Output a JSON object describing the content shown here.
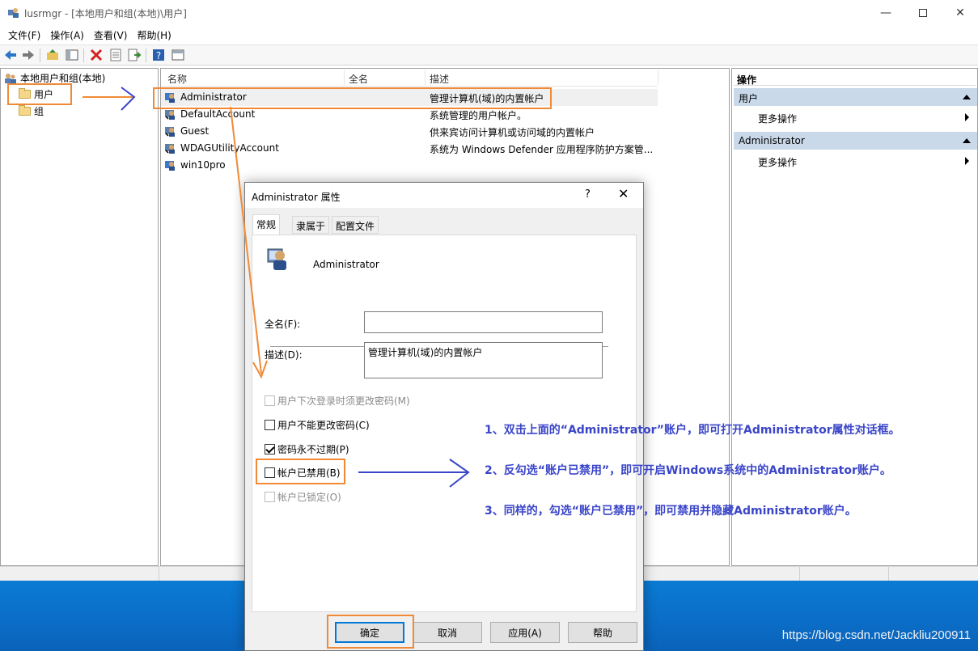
{
  "window": {
    "title": "lusrmgr - [本地用户和组(本地)\\用户]"
  },
  "menu": [
    "文件(F)",
    "操作(A)",
    "查看(V)",
    "帮助(H)"
  ],
  "tree": {
    "root": "本地用户和组(本地)",
    "users": "用户",
    "groups": "组"
  },
  "list": {
    "columns": [
      "名称",
      "全名",
      "描述"
    ],
    "rows": [
      {
        "name": "Administrator",
        "desc": "管理计算机(域)的内置帐户"
      },
      {
        "name": "DefaultAccount",
        "desc": "系统管理的用户帐户。"
      },
      {
        "name": "Guest",
        "desc": "供来宾访问计算机或访问域的内置帐户"
      },
      {
        "name": "WDAGUtilityAccount",
        "desc": "系统为 Windows Defender 应用程序防护方案管..."
      },
      {
        "name": "win10pro",
        "desc": ""
      }
    ]
  },
  "actions": {
    "header": "操作",
    "section1": "用户",
    "section1_more": "更多操作",
    "section2": "Administrator",
    "section2_more": "更多操作"
  },
  "dialog": {
    "title": "Administrator 属性",
    "help": "?",
    "close": "✕",
    "tabs": [
      "常规",
      "隶属于",
      "配置文件"
    ],
    "username": "Administrator",
    "fullname_label": "全名(F):",
    "fullname_value": "",
    "desc_label": "描述(D):",
    "desc_value": "管理计算机(域)的内置帐户",
    "checkboxes": [
      {
        "label": "用户下次登录时须更改密码(M)",
        "checked": false,
        "disabled": true
      },
      {
        "label": "用户不能更改密码(C)",
        "checked": false,
        "disabled": false
      },
      {
        "label": "密码永不过期(P)",
        "checked": true,
        "disabled": false
      },
      {
        "label": "帐户已禁用(B)",
        "checked": false,
        "disabled": false
      },
      {
        "label": "帐户已锁定(O)",
        "checked": false,
        "disabled": true
      }
    ],
    "buttons": {
      "ok": "确定",
      "cancel": "取消",
      "apply": "应用(A)",
      "help": "帮助"
    }
  },
  "notes": [
    "1、双击上面的“Administrator”账户，即可打开Administrator属性对话框。",
    "2、反勾选“账户已禁用”，即可开启Windows系统中的Administrator账户。",
    "3、同样的，勾选“账户已禁用”，即可禁用并隐藏Administrator账户。"
  ],
  "watermark": "https://blog.csdn.net/Jackliu200911",
  "colors": {
    "annotation_orange": "#f08a36",
    "annotation_blue": "#3a45c8",
    "selection_header": "#c9d9ea",
    "taskbar": "#0b6dc7"
  }
}
